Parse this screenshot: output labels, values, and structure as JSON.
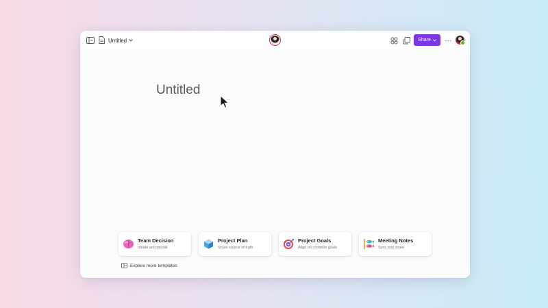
{
  "header": {
    "doc_title": "Untitled",
    "share_label": "Share",
    "more_label": "···"
  },
  "icons": {
    "sidebar": "sidebar-toggle-icon",
    "document": "document-icon",
    "apps": "apps-icon",
    "copy": "copy-icon",
    "chevron": "chevron-down-icon",
    "templates": "templates-icon"
  },
  "colors": {
    "accent": "#7c36e9",
    "avatar_ring": "#c4314b",
    "presence": "#6bb700"
  },
  "page": {
    "title": "Untitled"
  },
  "templates": [
    {
      "name": "Team Decision",
      "description": "Ideate and decide",
      "icon": "brain-icon"
    },
    {
      "name": "Project Plan",
      "description": "Share source of truth",
      "icon": "cube-icon"
    },
    {
      "name": "Project Goals",
      "description": "Align on common goals",
      "icon": "target-icon"
    },
    {
      "name": "Meeting Notes",
      "description": "Sync and share",
      "icon": "fish-icon"
    }
  ],
  "explore": {
    "label": "Explore more templates"
  }
}
